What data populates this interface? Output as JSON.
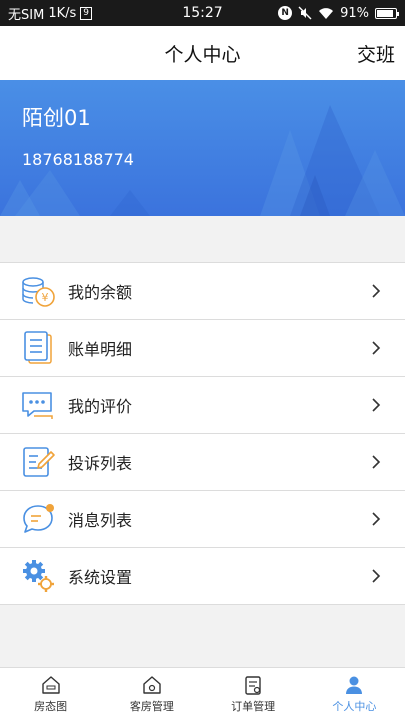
{
  "status_bar": {
    "carrier": "无SIM",
    "speed": "1K/s",
    "sim_badge": "9",
    "time": "15:27",
    "nfc": "N",
    "battery": "91%",
    "battery_level": 91
  },
  "nav": {
    "title": "个人中心",
    "action": "交班"
  },
  "profile": {
    "name": "陌创01",
    "phone": "18768188774"
  },
  "menu": {
    "items": [
      {
        "label": "我的余额",
        "icon": "coins-icon"
      },
      {
        "label": "账单明细",
        "icon": "bill-icon"
      },
      {
        "label": "我的评价",
        "icon": "comment-icon"
      },
      {
        "label": "投诉列表",
        "icon": "complaint-icon"
      },
      {
        "label": "消息列表",
        "icon": "message-icon"
      },
      {
        "label": "系统设置",
        "icon": "settings-icon"
      }
    ]
  },
  "tabs": [
    {
      "label": "房态图",
      "icon": "room-status-icon",
      "active": false
    },
    {
      "label": "客房管理",
      "icon": "room-manage-icon",
      "active": false
    },
    {
      "label": "订单管理",
      "icon": "order-icon",
      "active": false
    },
    {
      "label": "个人中心",
      "icon": "person-icon",
      "active": true
    }
  ],
  "colors": {
    "accent": "#4a90e2",
    "banner": "#3b73dd",
    "icon_orange": "#f0a33a"
  }
}
